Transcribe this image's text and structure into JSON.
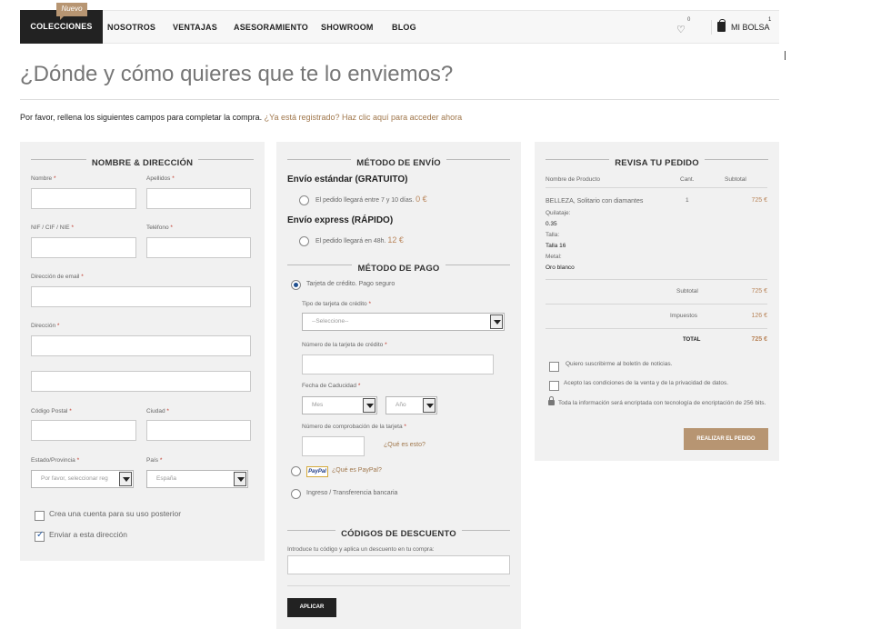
{
  "nav": {
    "items": [
      "COLECCIONES",
      "NOSOTROS",
      "VENTAJAS",
      "ASESORAMIENTO",
      "SHOWROOM",
      "BLOG"
    ],
    "badge": "Nuevo",
    "wishlist_count": "0",
    "bag_label": "MI BOLSA",
    "bag_count": "1"
  },
  "page": {
    "title": "¿Dónde y cómo quieres que te lo enviemos?",
    "intro_text": "Por favor, rellena los siguientes campos para completar la compra.",
    "intro_link": "¿Ya está registrado? Haz clic aquí para acceder ahora"
  },
  "address": {
    "title": "NOMBRE & DIRECCIÓN",
    "nombre": "Nombre",
    "apellidos": "Apellidos",
    "nif": "NIF / CIF / NIE",
    "telefono": "Teléfono",
    "email": "Dirección de email",
    "direccion": "Dirección",
    "codigo_postal": "Código Postal",
    "ciudad": "Ciudad",
    "estado": "Estado/Provincia",
    "pais": "País",
    "estado_select": "Por favor, seleccionar reg",
    "pais_select": "España",
    "required": "*",
    "create_account": "Crea una cuenta para su uso posterior",
    "ship_here": "Enviar a esta dirección",
    "create_account_checked": false,
    "ship_here_checked": true
  },
  "shipping": {
    "title": "MÉTODO DE ENVÍO",
    "standard_title": "Envío estándar (GRATUITO)",
    "standard_text": "El pedido llegará entre 7 y 10 días.",
    "standard_price": "0 €",
    "express_title": "Envío express (RÁPIDO)",
    "express_text": "El pedido llegará en 48h.",
    "express_price": "12 €"
  },
  "payment": {
    "title": "MÉTODO DE PAGO",
    "card_option": "Tarjeta de crédito. Pago seguro",
    "card_type_label": "Tipo de tarjeta de crédito",
    "card_type_select": "--Seleccione--",
    "card_number_label": "Número de la tarjeta de crédito",
    "expiry_label": "Fecha de Caducidad",
    "month_select": "Mes",
    "year_select": "Año",
    "cvv_label": "Número de comprobación de la tarjeta",
    "cvv_help": "¿Qué es esto?",
    "paypal_logo": "PayPal",
    "paypal_help": "¿Qué es PayPal?",
    "transfer_option": "Ingreso / Transferencia bancaria",
    "required": "*"
  },
  "discount": {
    "title": "CÓDIGOS DE DESCUENTO",
    "label": "Introduce tu código y aplica un descuento en tu compra:",
    "button": "APLICAR"
  },
  "order": {
    "title": "REVISA TU PEDIDO",
    "col_product": "Nombre de Producto",
    "col_qty": "Cant.",
    "col_subtotal": "Subtotal",
    "product_name": "BELLEZA, Solitario con diamantes",
    "product_qty": "1",
    "product_price": "725 €",
    "attr1_label": "Quilataje:",
    "attr1_value": "0.35",
    "attr2_label": "Talla:",
    "attr2_value": "Talla 16",
    "attr3_label": "Metal:",
    "attr3_value": "Oro blanco",
    "subtotal_label": "Subtotal",
    "subtotal_value": "725 €",
    "tax_label": "Impuestos",
    "tax_value": "126 €",
    "total_label": "TOTAL",
    "total_value": "725 €",
    "newsletter": "Quiero suscribirme al boletín de noticias.",
    "terms": "Acepto las condiciones de la venta y de la privacidad de datos.",
    "security": "Toda la información será encriptada con tecnología de encriptación de 256 bits.",
    "button": "REALIZAR EL PEDIDO"
  }
}
